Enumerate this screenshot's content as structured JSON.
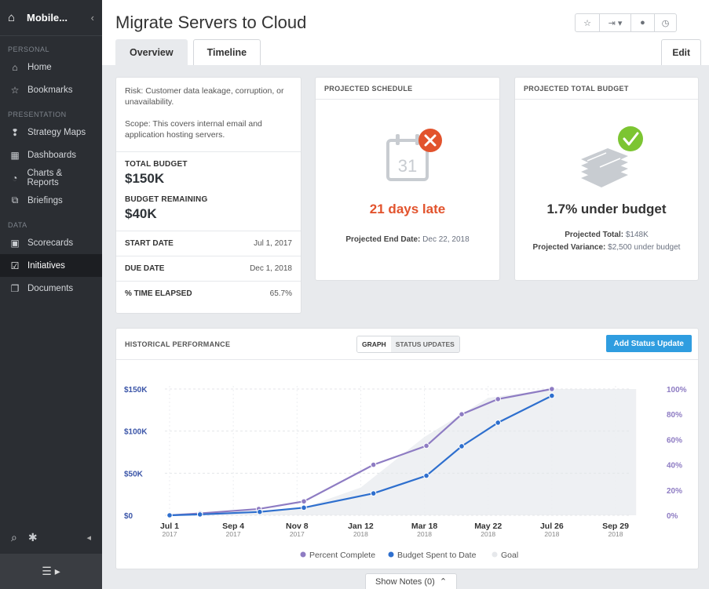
{
  "sidebar": {
    "app_name": "Mobile...",
    "collapse_glyph": "‹",
    "sections": [
      {
        "label": "PERSONAL",
        "items": [
          {
            "label": "Home",
            "icon": "home-icon",
            "glyph": "⌂"
          },
          {
            "label": "Bookmarks",
            "icon": "star-icon",
            "glyph": "☆"
          }
        ]
      },
      {
        "label": "PRESENTATION",
        "items": [
          {
            "label": "Strategy Maps",
            "icon": "strategy-map-icon",
            "glyph": "❢"
          },
          {
            "label": "Dashboards",
            "icon": "dashboard-icon",
            "glyph": "▦"
          },
          {
            "label": "Charts & Reports",
            "icon": "pie-chart-icon",
            "glyph": "◔"
          },
          {
            "label": "Briefings",
            "icon": "book-icon",
            "glyph": "⧉"
          }
        ]
      },
      {
        "label": "DATA",
        "items": [
          {
            "label": "Scorecards",
            "icon": "scorecard-icon",
            "glyph": "▣"
          },
          {
            "label": "Initiatives",
            "icon": "checkbox-icon",
            "glyph": "☑",
            "active": true
          },
          {
            "label": "Documents",
            "icon": "documents-icon",
            "glyph": "❐"
          }
        ]
      }
    ]
  },
  "header": {
    "title": "Migrate Servers to Cloud",
    "tabs": [
      "Overview",
      "Timeline"
    ],
    "active_tab": 0,
    "edit_label": "Edit"
  },
  "info": {
    "risk": "Risk: Customer data leakage, corruption, or unavailability.",
    "scope": "Scope: This covers internal email and application hosting servers.",
    "total_budget_label": "TOTAL BUDGET",
    "total_budget_value": "$150K",
    "remaining_label": "BUDGET REMAINING",
    "remaining_value": "$40K",
    "rows": [
      {
        "label": "START DATE",
        "value": "Jul 1, 2017"
      },
      {
        "label": "DUE DATE",
        "value": "Dec 1, 2018"
      },
      {
        "label": "% TIME ELAPSED",
        "value": "65.7%"
      }
    ]
  },
  "schedule": {
    "heading": "PROJECTED SCHEDULE",
    "calendar_day": "31",
    "status": "21 days late",
    "end_label": "Projected End Date:",
    "end_value": "Dec 22, 2018"
  },
  "budget": {
    "heading": "PROJECTED TOTAL BUDGET",
    "status": "1.7% under budget",
    "total_label": "Projected Total:",
    "total_value": "$148K",
    "variance_label": "Projected Variance:",
    "variance_value": "$2,500 under budget"
  },
  "performance": {
    "heading": "HISTORICAL PERFORMANCE",
    "views": [
      "GRAPH",
      "STATUS UPDATES"
    ],
    "active_view": 0,
    "add_label": "Add Status Update"
  },
  "footer": {
    "show_notes": "Show Notes (0)"
  },
  "colors": {
    "percent": "#8e7cc3",
    "budget": "#2e6fce",
    "late": "#e2532d",
    "ok": "#7cc532",
    "accent": "#2f9de0"
  },
  "chart_data": {
    "type": "line",
    "x_ticks": [
      {
        "label": "Jul 1",
        "year": "2017"
      },
      {
        "label": "Sep 4",
        "year": "2017"
      },
      {
        "label": "Nov 8",
        "year": "2017"
      },
      {
        "label": "Jan 12",
        "year": "2018"
      },
      {
        "label": "Mar 18",
        "year": "2018"
      },
      {
        "label": "May 22",
        "year": "2018"
      },
      {
        "label": "Jul 26",
        "year": "2018"
      },
      {
        "label": "Sep 29",
        "year": "2018"
      }
    ],
    "y_left_ticks": [
      "$0",
      "$50K",
      "$100K",
      "$150K"
    ],
    "y_left_range": [
      0,
      150000
    ],
    "y_right_ticks": [
      "0%",
      "20%",
      "40%",
      "60%",
      "80%",
      "100%"
    ],
    "y_right_range": [
      0,
      100
    ],
    "series": [
      {
        "name": "Percent Complete",
        "axis": "right",
        "points": [
          {
            "x": "2017-07-01",
            "y": 0
          },
          {
            "x": "2017-08-01",
            "y": 1.5
          },
          {
            "x": "2017-09-30",
            "y": 5
          },
          {
            "x": "2017-11-15",
            "y": 11
          },
          {
            "x": "2018-01-25",
            "y": 40
          },
          {
            "x": "2018-03-20",
            "y": 55
          },
          {
            "x": "2018-04-25",
            "y": 80
          },
          {
            "x": "2018-06-01",
            "y": 92
          },
          {
            "x": "2018-07-26",
            "y": 100
          }
        ]
      },
      {
        "name": "Budget Spent to Date",
        "axis": "left",
        "points": [
          {
            "x": "2017-07-01",
            "y": 0
          },
          {
            "x": "2017-08-01",
            "y": 1000
          },
          {
            "x": "2017-10-01",
            "y": 4000
          },
          {
            "x": "2017-11-15",
            "y": 9000
          },
          {
            "x": "2018-01-25",
            "y": 26000
          },
          {
            "x": "2018-03-20",
            "y": 47000
          },
          {
            "x": "2018-04-25",
            "y": 82000
          },
          {
            "x": "2018-06-01",
            "y": 110000
          },
          {
            "x": "2018-07-26",
            "y": 142000
          }
        ]
      },
      {
        "name": "Goal",
        "axis": "right",
        "type": "area",
        "points": [
          {
            "x": "2017-07-01",
            "y": 0
          },
          {
            "x": "2017-11-15",
            "y": 6
          },
          {
            "x": "2018-01-12",
            "y": 22
          },
          {
            "x": "2018-03-18",
            "y": 62
          },
          {
            "x": "2018-05-22",
            "y": 93
          },
          {
            "x": "2018-07-26",
            "y": 100
          },
          {
            "x": "2018-10-20",
            "y": 100
          }
        ]
      }
    ],
    "legend": [
      "Percent Complete",
      "Budget Spent to Date",
      "Goal"
    ],
    "legend_position": "bottom"
  }
}
